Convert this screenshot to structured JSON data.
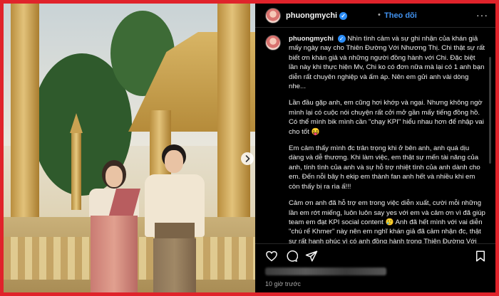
{
  "post": {
    "username": "phuongmychi",
    "follow_label": "Theo dõi",
    "more_label": "···",
    "timestamp": "10 giờ trước",
    "caption_username": "phuongmychi",
    "paragraphs": [
      "Nhìn tình cảm và sự ghi nhận của khán giả mấy ngày nay cho Thiên Đường Với Nhương Thị. Chi thật sự rất biết ơn khán giả và những người đồng hành với Chi. Đặc biệt lần này khi thực hiện Mv, Chi ko có đơn nữa mà lại có 1 anh bạn diễn rất chuyên nghiệp và ấm áp. Nên em gửi anh vài dòng nhe...",
      "Lần đầu gặp anh, em cũng hơi khớp và ngại. Nhưng không ngờ mình lại có cuộc nói chuyện rất cởi mở gần mấy tiếng đồng hồ. Có thể mình bik mình cần \"chạy KPI\" hiểu nhau hơn để nhập vai cho tốt 😝",
      "Em cảm thấy mình đc trân trọng khi ở bên anh, anh quá dịu dàng và dễ thương. Khi làm việc, em thật sự mến tài năng của anh, tính tình của anh và sự hỗ trợ nhiệt tình của anh dành cho em. Đến nỗi bây h ekip em thành fan anh hết và nhiều khi em còn thấy bị ra rìa ấ!!!",
      "Cảm ơn anh đã hỗ trợ em trong việc diễn xuất, cười mỗi những lần em rớt miếng, luôn luôn say yes với em và cảm ơn vì đã giúp team em đạt KPI social content 🥲 Anh đã hết mình với vai diễn \"chú rể Khmer\" này nên em nghĩ khán giả đã cảm nhận đc, thật sự rất hạnh phúc vì có anh đồng hành trong Thiên Đường Với Nhương Thị"
    ]
  },
  "icons": {
    "like": "heart-icon",
    "comment": "comment-icon",
    "share": "share-icon",
    "save": "bookmark-icon",
    "next": "chevron-right-icon",
    "verified": "verified-badge-icon"
  },
  "colors": {
    "frame": "#e0232b",
    "follow": "#4192ef",
    "verified": "#2c8df6"
  }
}
